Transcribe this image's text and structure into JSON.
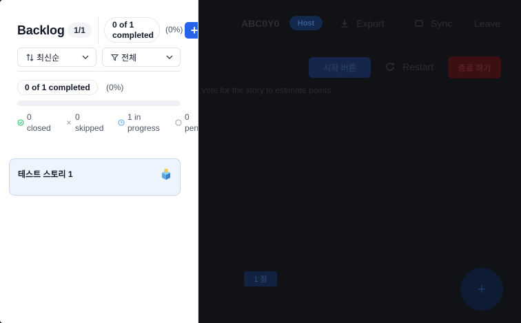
{
  "background": {
    "title": "ABC0Y0",
    "badge": "Host",
    "export_label": "Export",
    "sync_label": "Sync",
    "leave_label": "Leave",
    "left_button": "시작 버튼",
    "refresh_label": "Restart",
    "red_button": "종료 하기",
    "description": "Vote for the story to estimate points",
    "chip_label": "1 점",
    "fab_label": "+"
  },
  "panel": {
    "title": "Backlog",
    "count": "1/1",
    "completed_top_line1": "0 of 1",
    "completed_top_line2": "completed",
    "percent_top": "(0%)",
    "add_label": "+",
    "sort_label": "최신순",
    "filter_label": "전체",
    "completed_summary": "0 of 1 completed",
    "percent": "(0%)",
    "progress_fraction": 0,
    "stats": {
      "closed_count": "0",
      "closed_label": "closed",
      "skipped_count": "0",
      "skipped_label": "skipped",
      "in_progress_count": "1 in",
      "in_progress_label": "progress",
      "pending_count": "0",
      "pending_label": "pending"
    },
    "stories": [
      {
        "title": "테스트 스토리 1",
        "icon": "vote-box-icon"
      }
    ]
  },
  "colors": {
    "accent": "#2563eb",
    "closed": "#22c55e",
    "in_progress": "#60a5fa",
    "story_bg": "#eef4fe"
  }
}
